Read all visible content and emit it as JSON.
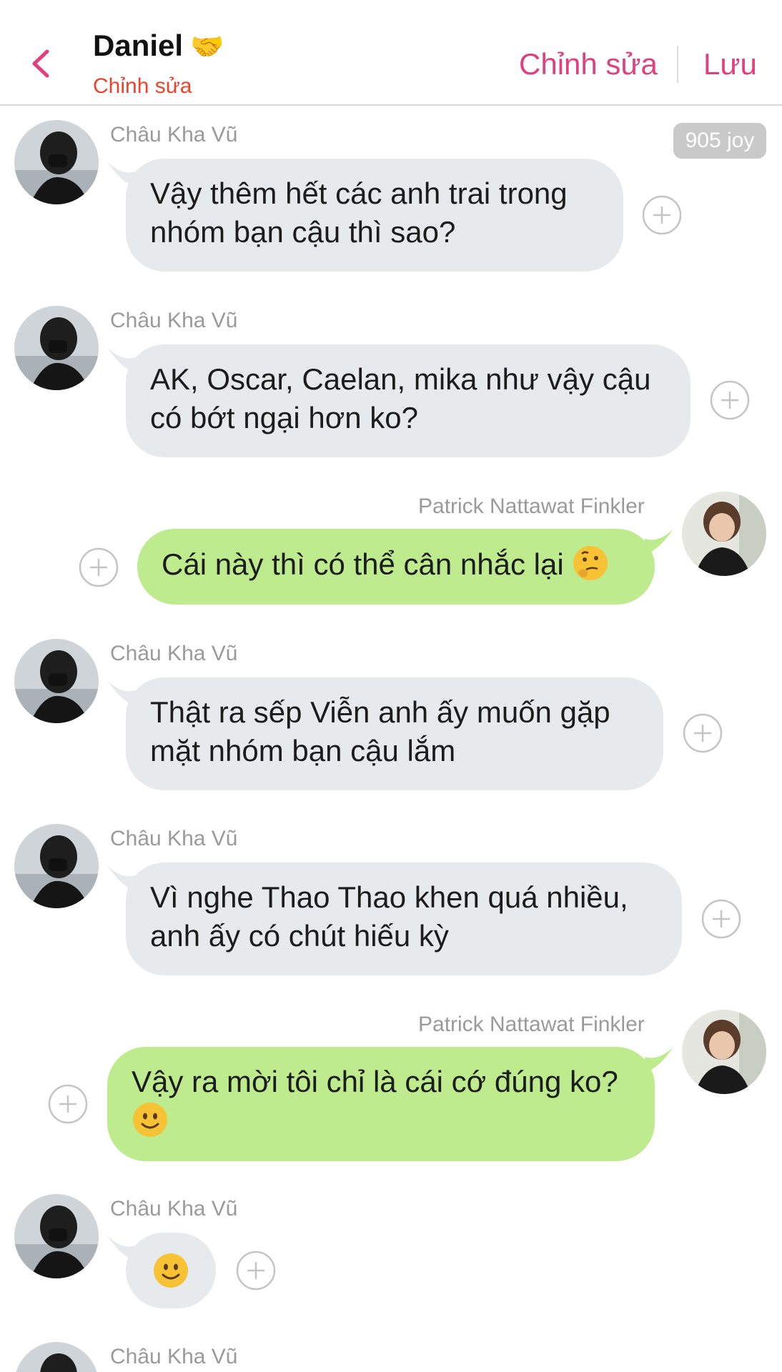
{
  "header": {
    "title": "Daniel",
    "title_emoji": "🤝",
    "subtitle": "Chỉnh sửa",
    "edit_label": "Chỉnh sửa",
    "save_label": "Lưu"
  },
  "coin_badge": "905 joy",
  "colors": {
    "accent": "#e0407f",
    "subtitle": "#e8442e",
    "incoming_bubble": "#e7eaed",
    "outgoing_bubble": "#bdeb8e"
  },
  "messages": [
    {
      "side": "in",
      "sender": "Châu Kha Vũ",
      "line1": "Vậy thêm hết các anh trai trong",
      "line2": "nhóm bạn cậu thì sao?"
    },
    {
      "side": "in",
      "sender": "Châu Kha Vũ",
      "line1": "AK, Oscar, Caelan, mika như vậy cậu",
      "line2": "có bớt ngại hơn ko?"
    },
    {
      "side": "out",
      "sender": "Patrick Nattawat Finkler",
      "line1": "Cái này thì có thể cân nhắc lại",
      "emoji": "thinking-face"
    },
    {
      "side": "in",
      "sender": "Châu Kha Vũ",
      "line1": "Thật ra sếp Viễn anh ấy muốn gặp",
      "line2": "mặt nhóm bạn cậu lắm"
    },
    {
      "side": "in",
      "sender": "Châu Kha Vũ",
      "line1": "Vì nghe Thao Thao khen quá nhiều,",
      "line2": "anh ấy có chút hiếu kỳ"
    },
    {
      "side": "out",
      "sender": "Patrick Nattawat Finkler",
      "line1": "Vậy ra mời tôi chỉ là cái cớ đúng ko?",
      "emoji": "slightly-smiling-face"
    },
    {
      "side": "in",
      "sender": "Châu Kha Vũ",
      "emoji": "slightly-smiling-face"
    },
    {
      "side": "in",
      "sender": "Châu Kha Vũ"
    }
  ]
}
